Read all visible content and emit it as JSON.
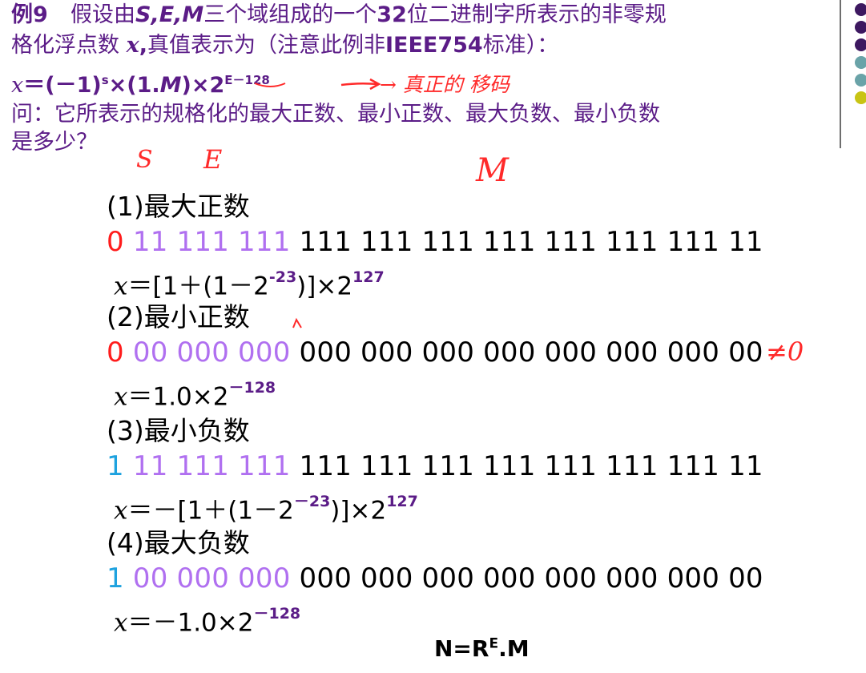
{
  "header": {
    "line1_prefix": "例9",
    "line1_text_a": "假设由",
    "line1_sem": "S,E,M",
    "line1_text_b": "三个域组成的一个",
    "line1_num": "32",
    "line1_text_c": "位二进制字所表示的非零规",
    "line2_text_a": "格化浮点数 ",
    "line2_x": "x",
    "line2_text_b": ",",
    "line2_text_c": "真值表示为（注意此例非",
    "line2_std": "IEEE754",
    "line2_text_d": "标准）：",
    "line3_x": "x",
    "line3_formula": "＝(－1)",
    "line3_sup_s": "s",
    "line3_times": "×(1.",
    "line3_m": "M",
    "line3_close": ")×2",
    "line3_sup_exp": "E－128",
    "line4": "问：它所表示的规格化的最大正数、最小正数、最大负数、最小负数",
    "line5": "是多少？"
  },
  "sections": [
    {
      "title": "(1)最大正数",
      "sign": "0",
      "exponent": "11 111 111",
      "mantissa": "111 111 111 111 111 111 111 11",
      "formula_x": "x",
      "formula_a": "＝[1＋(1－2",
      "formula_sup1": "-23",
      "formula_b": ")]×2",
      "formula_sup2": "127"
    },
    {
      "title": "(2)最小正数",
      "sign": "0",
      "exponent": "00 000 000",
      "mantissa": "000 000 000 000 000 000 000 00",
      "formula_x": "x",
      "formula_a": "＝1.0×2",
      "formula_sup1": "－128",
      "formula_b": "",
      "formula_sup2": ""
    },
    {
      "title": "(3)最小负数",
      "sign": "1",
      "exponent": "11 111 111",
      "mantissa": "111 111 111 111 111 111 111 11",
      "formula_x": "x",
      "formula_a": "＝－[1＋(1－2",
      "formula_sup1": "－23",
      "formula_b": ")]×2",
      "formula_sup2": "127"
    },
    {
      "title": "(4)最大负数",
      "sign": "1",
      "exponent": "00 000 000",
      "mantissa": "000 000 000 000 000 000 000 00",
      "formula_x": "x",
      "formula_a": "＝－1.0×2",
      "formula_sup1": "－128",
      "formula_b": "",
      "formula_sup2": ""
    }
  ],
  "handwriting": {
    "arrow_note": "→ 真正的 移码",
    "s_mark": "S",
    "e_mark": "E",
    "m_mark": "M",
    "neq_zero": "≠0"
  },
  "bottom": {
    "text_a": "N=R",
    "sup": "E",
    "text_b": ".M"
  },
  "colors": {
    "title_purple": "#5b1c87",
    "sign_positive": "#ff1c1c",
    "sign_negative": "#1ea2df",
    "exponent": "#b070f0",
    "handwriting": "#ff2a2a"
  }
}
